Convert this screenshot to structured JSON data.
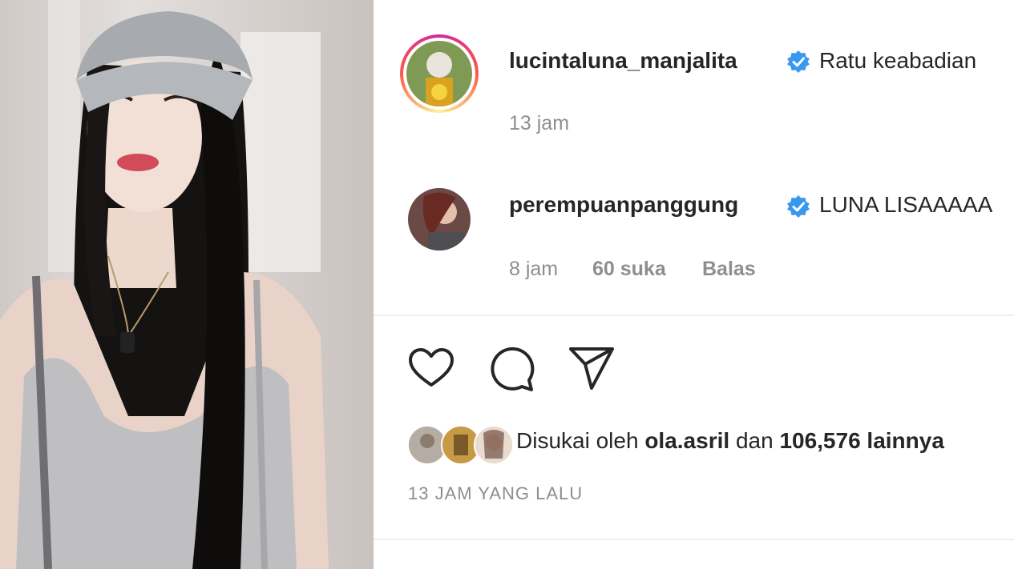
{
  "comments": [
    {
      "username": "lucintaluna_manjalita",
      "text": "Ratu keabadian",
      "time": "13 jam",
      "verified": true
    },
    {
      "username": "perempuanpanggung",
      "text": "LUNA LISAAAAA",
      "time": "8 jam",
      "likes": "60 suka",
      "reply": "Balas",
      "verified": true
    }
  ],
  "actions": {
    "like_icon": "heart-icon",
    "comment_icon": "comment-icon",
    "share_icon": "send-icon"
  },
  "liked_by": {
    "prefix": "Disukai oleh",
    "user": "ola.asril",
    "connector": "dan",
    "others": "106,576 lainnya"
  },
  "post_time": "13 JAM YANG LALU",
  "colors": {
    "verified_badge": "#3897f0",
    "muted_text": "#8e8e8e",
    "divider": "#efefef"
  }
}
